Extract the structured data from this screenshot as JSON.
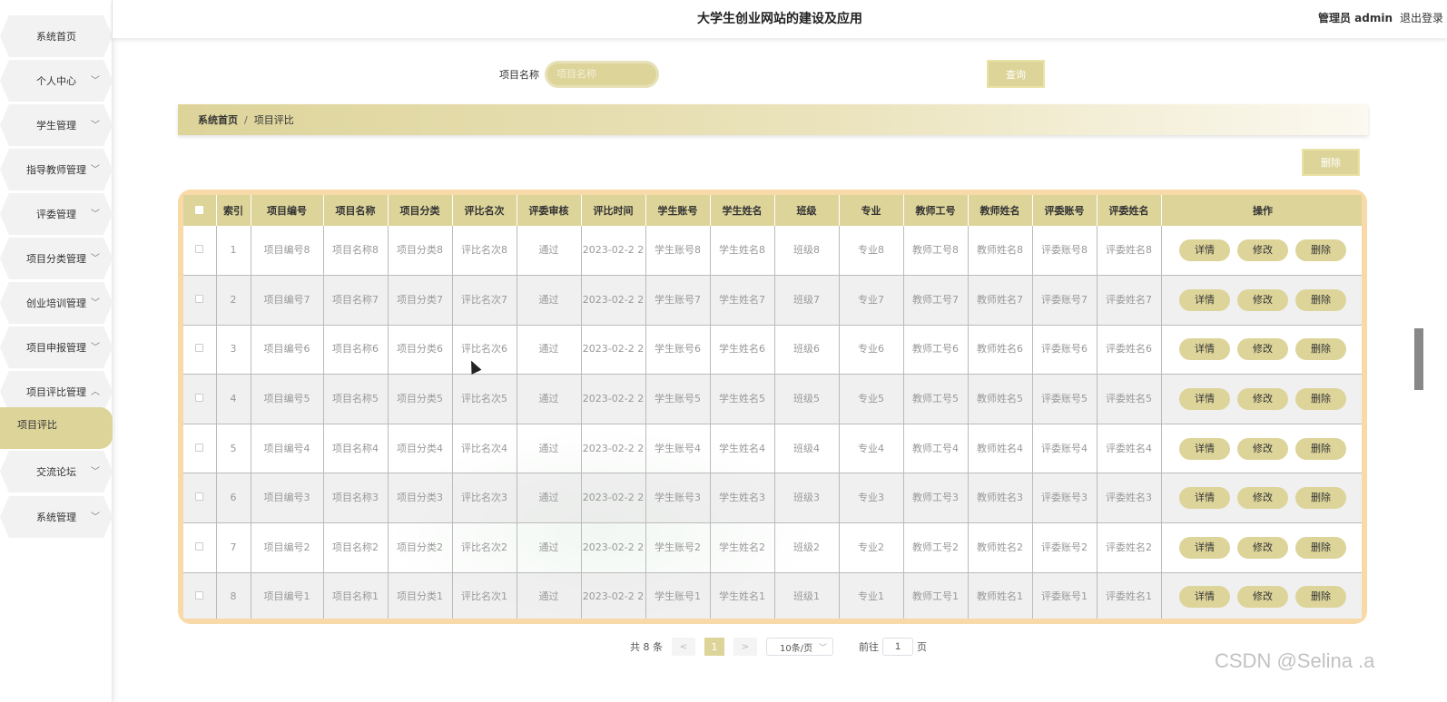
{
  "header": {
    "title": "大学生创业网站的建设及应用",
    "user": "管理员 admin",
    "logout": "退出登录"
  },
  "sidebar": {
    "items": [
      {
        "label": "系统首页",
        "chevron": ""
      },
      {
        "label": "个人中心",
        "chevron": "﹀"
      },
      {
        "label": "学生管理",
        "chevron": "﹀"
      },
      {
        "label": "指导教师管理",
        "chevron": "﹀"
      },
      {
        "label": "评委管理",
        "chevron": "﹀"
      },
      {
        "label": "项目分类管理",
        "chevron": "﹀"
      },
      {
        "label": "创业培训管理",
        "chevron": "﹀"
      },
      {
        "label": "项目申报管理",
        "chevron": "﹀"
      },
      {
        "label": "项目评比管理",
        "chevron": "︿"
      },
      {
        "label": "项目评比",
        "chevron": ""
      },
      {
        "label": "交流论坛",
        "chevron": "﹀"
      },
      {
        "label": "系统管理",
        "chevron": "﹀"
      }
    ]
  },
  "search": {
    "label": "项目名称",
    "placeholder": "项目名称",
    "button": "查询"
  },
  "breadcrumb": {
    "home": "系统首页",
    "separator": "/",
    "current": "项目评比"
  },
  "toolbar": {
    "delete": "删除"
  },
  "table": {
    "headers": [
      "索引",
      "项目编号",
      "项目名称",
      "项目分类",
      "评比名次",
      "评委审核",
      "评比时间",
      "学生账号",
      "学生姓名",
      "班级",
      "专业",
      "教师工号",
      "教师姓名",
      "评委账号",
      "评委姓名",
      "操作"
    ],
    "rows": [
      [
        "1",
        "项目编号8",
        "项目名称8",
        "项目分类8",
        "评比名次8",
        "通过",
        "2023-02-2 2",
        "学生账号8",
        "学生姓名8",
        "班级8",
        "专业8",
        "教师工号8",
        "教师姓名8",
        "评委账号8",
        "评委姓名8"
      ],
      [
        "2",
        "项目编号7",
        "项目名称7",
        "项目分类7",
        "评比名次7",
        "通过",
        "2023-02-2 2",
        "学生账号7",
        "学生姓名7",
        "班级7",
        "专业7",
        "教师工号7",
        "教师姓名7",
        "评委账号7",
        "评委姓名7"
      ],
      [
        "3",
        "项目编号6",
        "项目名称6",
        "项目分类6",
        "评比名次6",
        "通过",
        "2023-02-2 2",
        "学生账号6",
        "学生姓名6",
        "班级6",
        "专业6",
        "教师工号6",
        "教师姓名6",
        "评委账号6",
        "评委姓名6"
      ],
      [
        "4",
        "项目编号5",
        "项目名称5",
        "项目分类5",
        "评比名次5",
        "通过",
        "2023-02-2 2",
        "学生账号5",
        "学生姓名5",
        "班级5",
        "专业5",
        "教师工号5",
        "教师姓名5",
        "评委账号5",
        "评委姓名5"
      ],
      [
        "5",
        "项目编号4",
        "项目名称4",
        "项目分类4",
        "评比名次4",
        "通过",
        "2023-02-2 2",
        "学生账号4",
        "学生姓名4",
        "班级4",
        "专业4",
        "教师工号4",
        "教师姓名4",
        "评委账号4",
        "评委姓名4"
      ],
      [
        "6",
        "项目编号3",
        "项目名称3",
        "项目分类3",
        "评比名次3",
        "通过",
        "2023-02-2 2",
        "学生账号3",
        "学生姓名3",
        "班级3",
        "专业3",
        "教师工号3",
        "教师姓名3",
        "评委账号3",
        "评委姓名3"
      ],
      [
        "7",
        "项目编号2",
        "项目名称2",
        "项目分类2",
        "评比名次2",
        "通过",
        "2023-02-2 2",
        "学生账号2",
        "学生姓名2",
        "班级2",
        "专业2",
        "教师工号2",
        "教师姓名2",
        "评委账号2",
        "评委姓名2"
      ],
      [
        "8",
        "项目编号1",
        "项目名称1",
        "项目分类1",
        "评比名次1",
        "通过",
        "2023-02-2 2",
        "学生账号1",
        "学生姓名1",
        "班级1",
        "专业1",
        "教师工号1",
        "教师姓名1",
        "评委账号1",
        "评委姓名1"
      ]
    ],
    "actions": [
      "详情",
      "修改",
      "删除"
    ]
  },
  "pagination": {
    "total": "共 8 条",
    "prev": "<",
    "next": ">",
    "current": "1",
    "page_size": "10条/页",
    "goto_label": "前往",
    "goto_value": "1",
    "page_unit": "页"
  },
  "watermark": "CSDN @Selina .a",
  "colors": {
    "accent": "#ddd49a",
    "table_border": "#f8d9a8"
  }
}
